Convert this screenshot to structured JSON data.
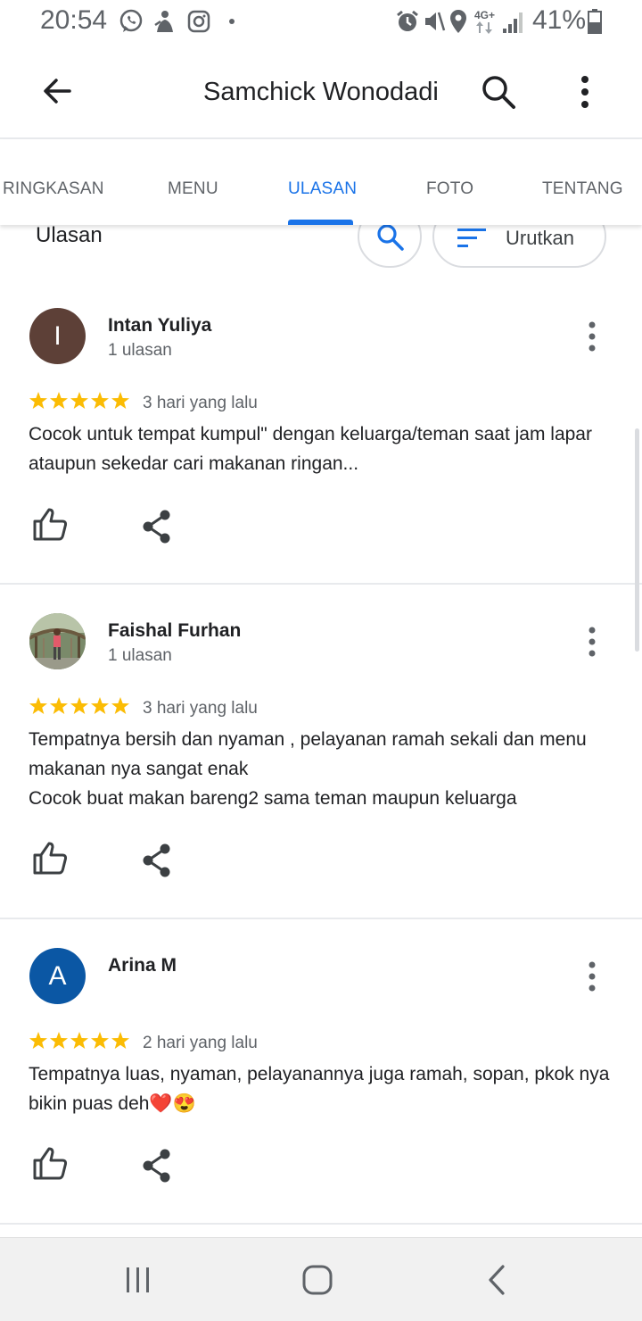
{
  "status_bar": {
    "time": "20:54",
    "battery_percent": "41%",
    "network": "4G+",
    "icons": [
      "whatsapp-icon",
      "notification-icon",
      "instagram-icon",
      "dot-icon",
      "alarm-icon",
      "mute-icon",
      "location-icon",
      "signal-icon",
      "battery-icon"
    ]
  },
  "app_bar": {
    "title": "Samchick Wonodadi",
    "back_icon": "arrow-back-icon",
    "search_icon": "search-icon",
    "more_icon": "more-vert-icon"
  },
  "tabs": [
    {
      "label": "RINGKASAN",
      "active": false
    },
    {
      "label": "MENU",
      "active": false
    },
    {
      "label": "ULASAN",
      "active": true
    },
    {
      "label": "FOTO",
      "active": false
    },
    {
      "label": "TENTANG",
      "active": false
    }
  ],
  "reviews_header": {
    "title": "Ulasan",
    "sort_label": "Urutkan"
  },
  "reviews": [
    {
      "name": "Intan Yuliya",
      "meta": "1 ulasan",
      "avatar_letter": "I",
      "avatar_color": "#5d4037",
      "rating": 5,
      "date": "3 hari yang lalu",
      "text": "Cocok untuk tempat kumpul\" dengan keluarga/teman saat jam lapar ataupun sekedar cari makanan ringan..."
    },
    {
      "name": "Faishal Furhan",
      "meta": "1 ulasan",
      "avatar_letter": "",
      "avatar_color": "#8d9a7a",
      "rating": 5,
      "date": "3 hari yang lalu",
      "text": "Tempatnya bersih dan nyaman , pelayanan ramah sekali dan menu makanan nya sangat enak\nCocok buat makan bareng2 sama teman maupun keluarga"
    },
    {
      "name": "Arina M",
      "meta": "",
      "avatar_letter": "A",
      "avatar_color": "#0b57a4",
      "rating": 5,
      "date": "2 hari yang lalu",
      "text": "Tempatnya luas, nyaman, pelayanannya juga ramah, sopan, pkok nya bikin puas deh❤️😍"
    }
  ],
  "colors": {
    "accent": "#1a73e8",
    "star": "#fbbc04",
    "divider": "#e8eaed"
  },
  "nav_bar": {
    "icons": [
      "recent-apps-icon",
      "home-icon",
      "back-icon"
    ]
  }
}
